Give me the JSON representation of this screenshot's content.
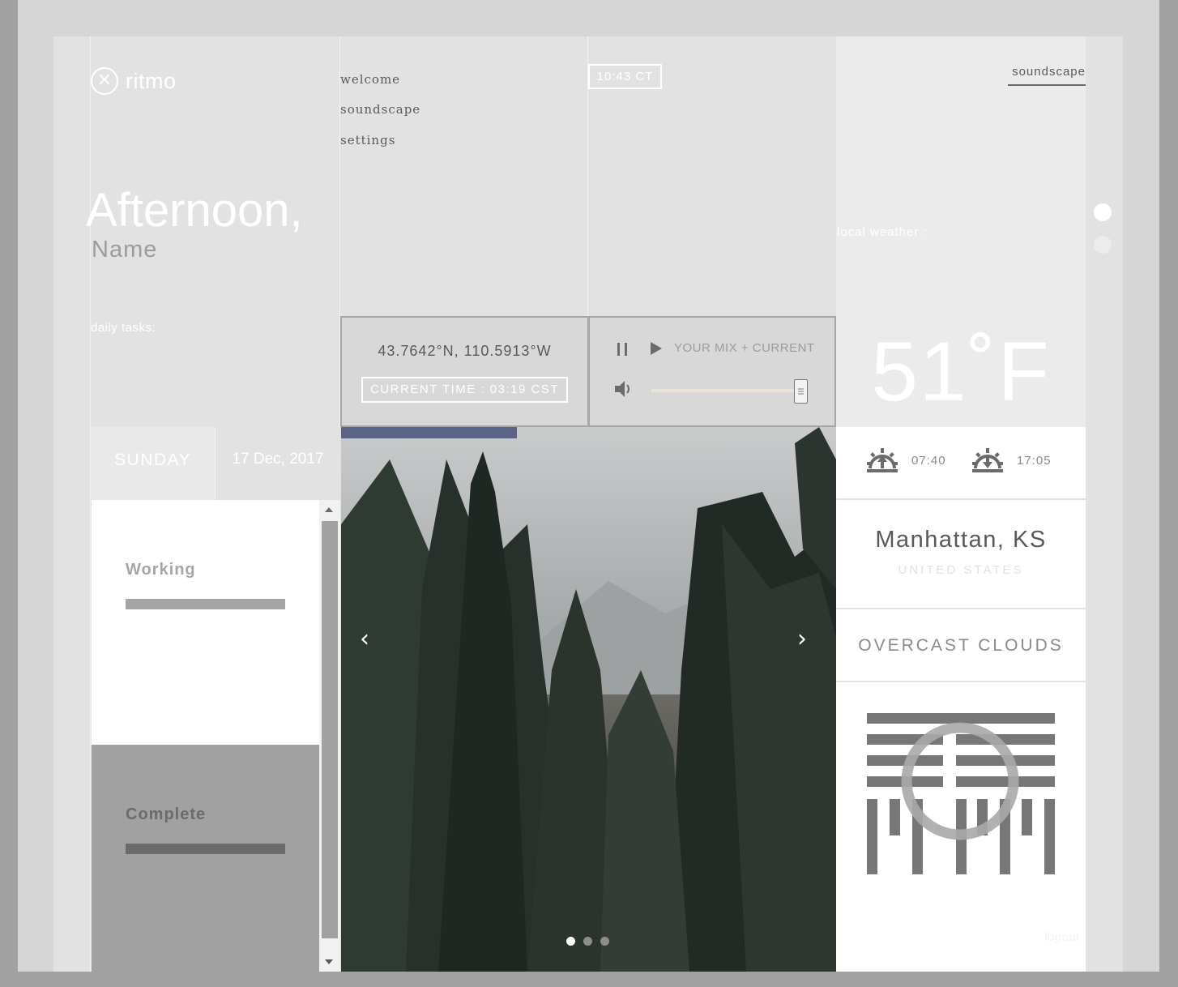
{
  "brand": {
    "name": "ritmo",
    "icon": "close-circle-icon"
  },
  "greeting": {
    "line1": "Afternoon,",
    "name": "Name"
  },
  "tasks_label": "daily tasks:",
  "nav": {
    "items": [
      "welcome",
      "soundscape",
      "settings"
    ]
  },
  "clock": "10:43 CT",
  "header_link": "soundscape",
  "weather": {
    "label": "local weather :",
    "temperature": "51˚F",
    "sunrise": "07:40",
    "sunset": "17:05",
    "sunrise_icon": "sunrise-icon",
    "sunset_icon": "sunset-icon",
    "city": "Manhattan, KS",
    "country": "UNITED STATES",
    "condition": "OVERCAST CLOUDS",
    "condition_icon": "overcast-clouds-icon"
  },
  "location": {
    "coordinates": "43.7642°N, 110.5913°W",
    "current_time": "CURRENT TIME : 03:19 CST"
  },
  "player": {
    "pause_icon": "pause-icon",
    "play_icon": "play-icon",
    "volume_icon": "volume-icon",
    "mix_label": "YOUR MIX + CURRENT",
    "volume_level": 1.0
  },
  "date": {
    "day": "SUNDAY",
    "date": "17 Dec, 2017"
  },
  "task_list": [
    {
      "title": "Working",
      "bar_color": "#a5a5a5"
    },
    {
      "title": "Complete",
      "bar_color": "#6b6b6b"
    }
  ],
  "slider": {
    "slide_count": 3,
    "active_slide": 1,
    "prev_icon": "chevron-left-icon",
    "next_icon": "chevron-right-icon"
  },
  "page_dots": {
    "count": 2,
    "active": 1
  },
  "logout": "logout",
  "colors": {
    "white": "#ffffff",
    "accent_gray": "#595959",
    "panel": "#e2e2e2",
    "frame": "#d6d6d6"
  }
}
